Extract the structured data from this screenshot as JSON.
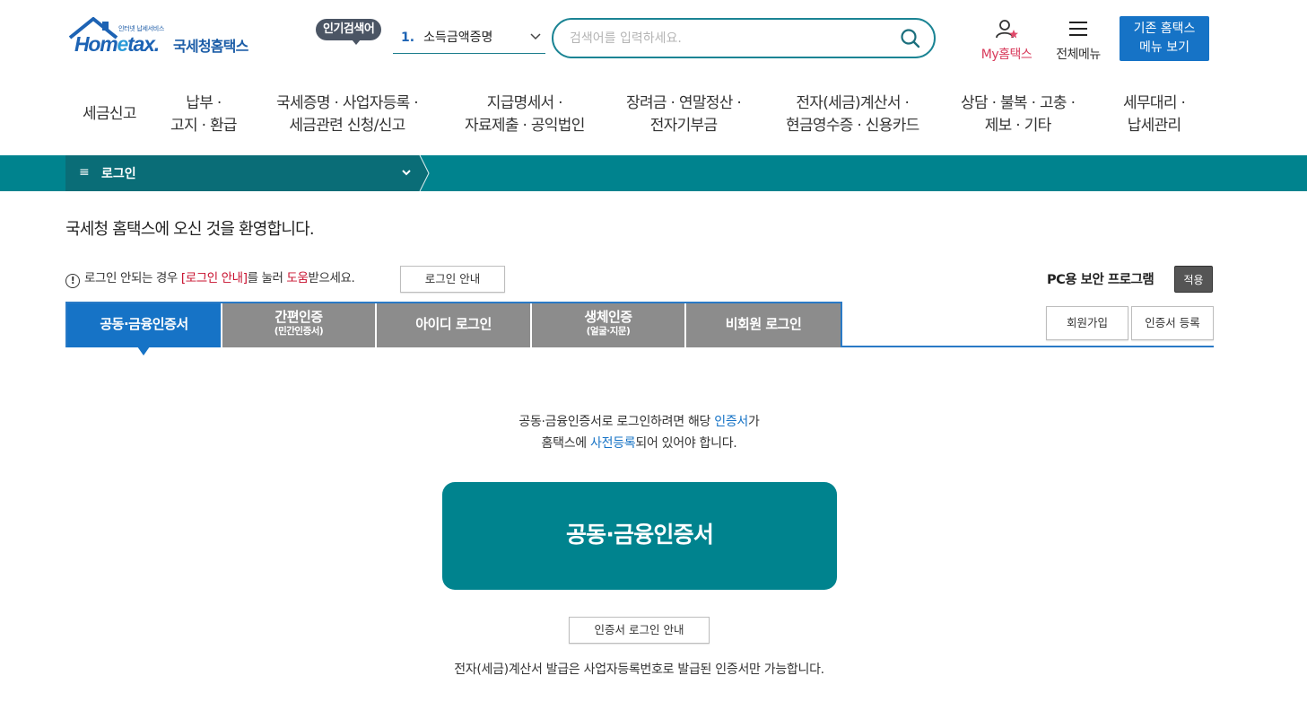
{
  "brand": {
    "logo_small": "인터넷 납세서비스",
    "logo_en_prefix": "Hom",
    "logo_en_e": "e",
    "logo_en_suffix": "tax.",
    "logo_ko": "국세청홈택스",
    "colors": {
      "primary": "#1673c6",
      "teal": "#00838e",
      "dark_teal": "#0a6d77",
      "red": "#c8102e"
    }
  },
  "header": {
    "popular_badge": "인기검색어",
    "popular": {
      "rank": "1.",
      "term": "소득금액증명"
    },
    "search_placeholder": "검색어를 입력하세요.",
    "my_label": "My홈택스",
    "all_menu_label": "전체메뉴",
    "old_menu_line1": "기존 홈택스",
    "old_menu_line2": "메뉴 보기"
  },
  "gnb": [
    {
      "line1": "세금신고",
      "line2": ""
    },
    {
      "line1": "납부 ·",
      "line2": "고지 · 환급"
    },
    {
      "line1": "국세증명 · 사업자등록 ·",
      "line2": "세금관련 신청/신고"
    },
    {
      "line1": "지급명세서 ·",
      "line2": "자료제출 · 공익법인"
    },
    {
      "line1": "장려금 · 연말정산 ·",
      "line2": "전자기부금"
    },
    {
      "line1": "전자(세금)계산서 ·",
      "line2": "현금영수증 · 신용카드"
    },
    {
      "line1": "상담 · 불복 · 고충 ·",
      "line2": "제보 · 기타"
    },
    {
      "line1": "세무대리 ·",
      "line2": "납세관리"
    }
  ],
  "location": {
    "label": "로그인"
  },
  "main": {
    "welcome": "국세청 홈택스에 오신 것을 환영합니다.",
    "notice_prefix": "로그인 안되는 경우 ",
    "notice_link": "[로그인 안내]",
    "notice_mid": "를 눌러 ",
    "notice_help": "도움",
    "notice_suffix": "받으세요.",
    "login_guide_btn": "로그인 안내",
    "pc_security": "PC용 보안 프로그램",
    "apply_btn": "적용",
    "tabs": [
      {
        "label": "공동·금융인증서",
        "sub": "",
        "active": true
      },
      {
        "label": "간편인증",
        "sub": "(민간인증서)",
        "active": false
      },
      {
        "label": "아이디 로그인",
        "sub": "",
        "active": false
      },
      {
        "label": "생체인증",
        "sub": "(얼굴·지문)",
        "active": false
      },
      {
        "label": "비회원 로그인",
        "sub": "",
        "active": false
      }
    ],
    "join_btn": "회원가입",
    "cert_reg_btn": "인증서 등록",
    "info_l1_a": "공동·금융인증서로 로그인하려면 해당 ",
    "info_l1_b": "인증서",
    "info_l1_c": "가",
    "info_l2_a": "홈택스에 ",
    "info_l2_b": "사전등록",
    "info_l2_c": "되어 있어야 합니다.",
    "cert_login_btn": "공동·금융인증서",
    "cert_guide_btn": "인증서 로그인 안내",
    "einvoice_info": "전자(세금)계산서 발급은 사업자등록번호로 발급된 인증서만 가능합니다."
  }
}
